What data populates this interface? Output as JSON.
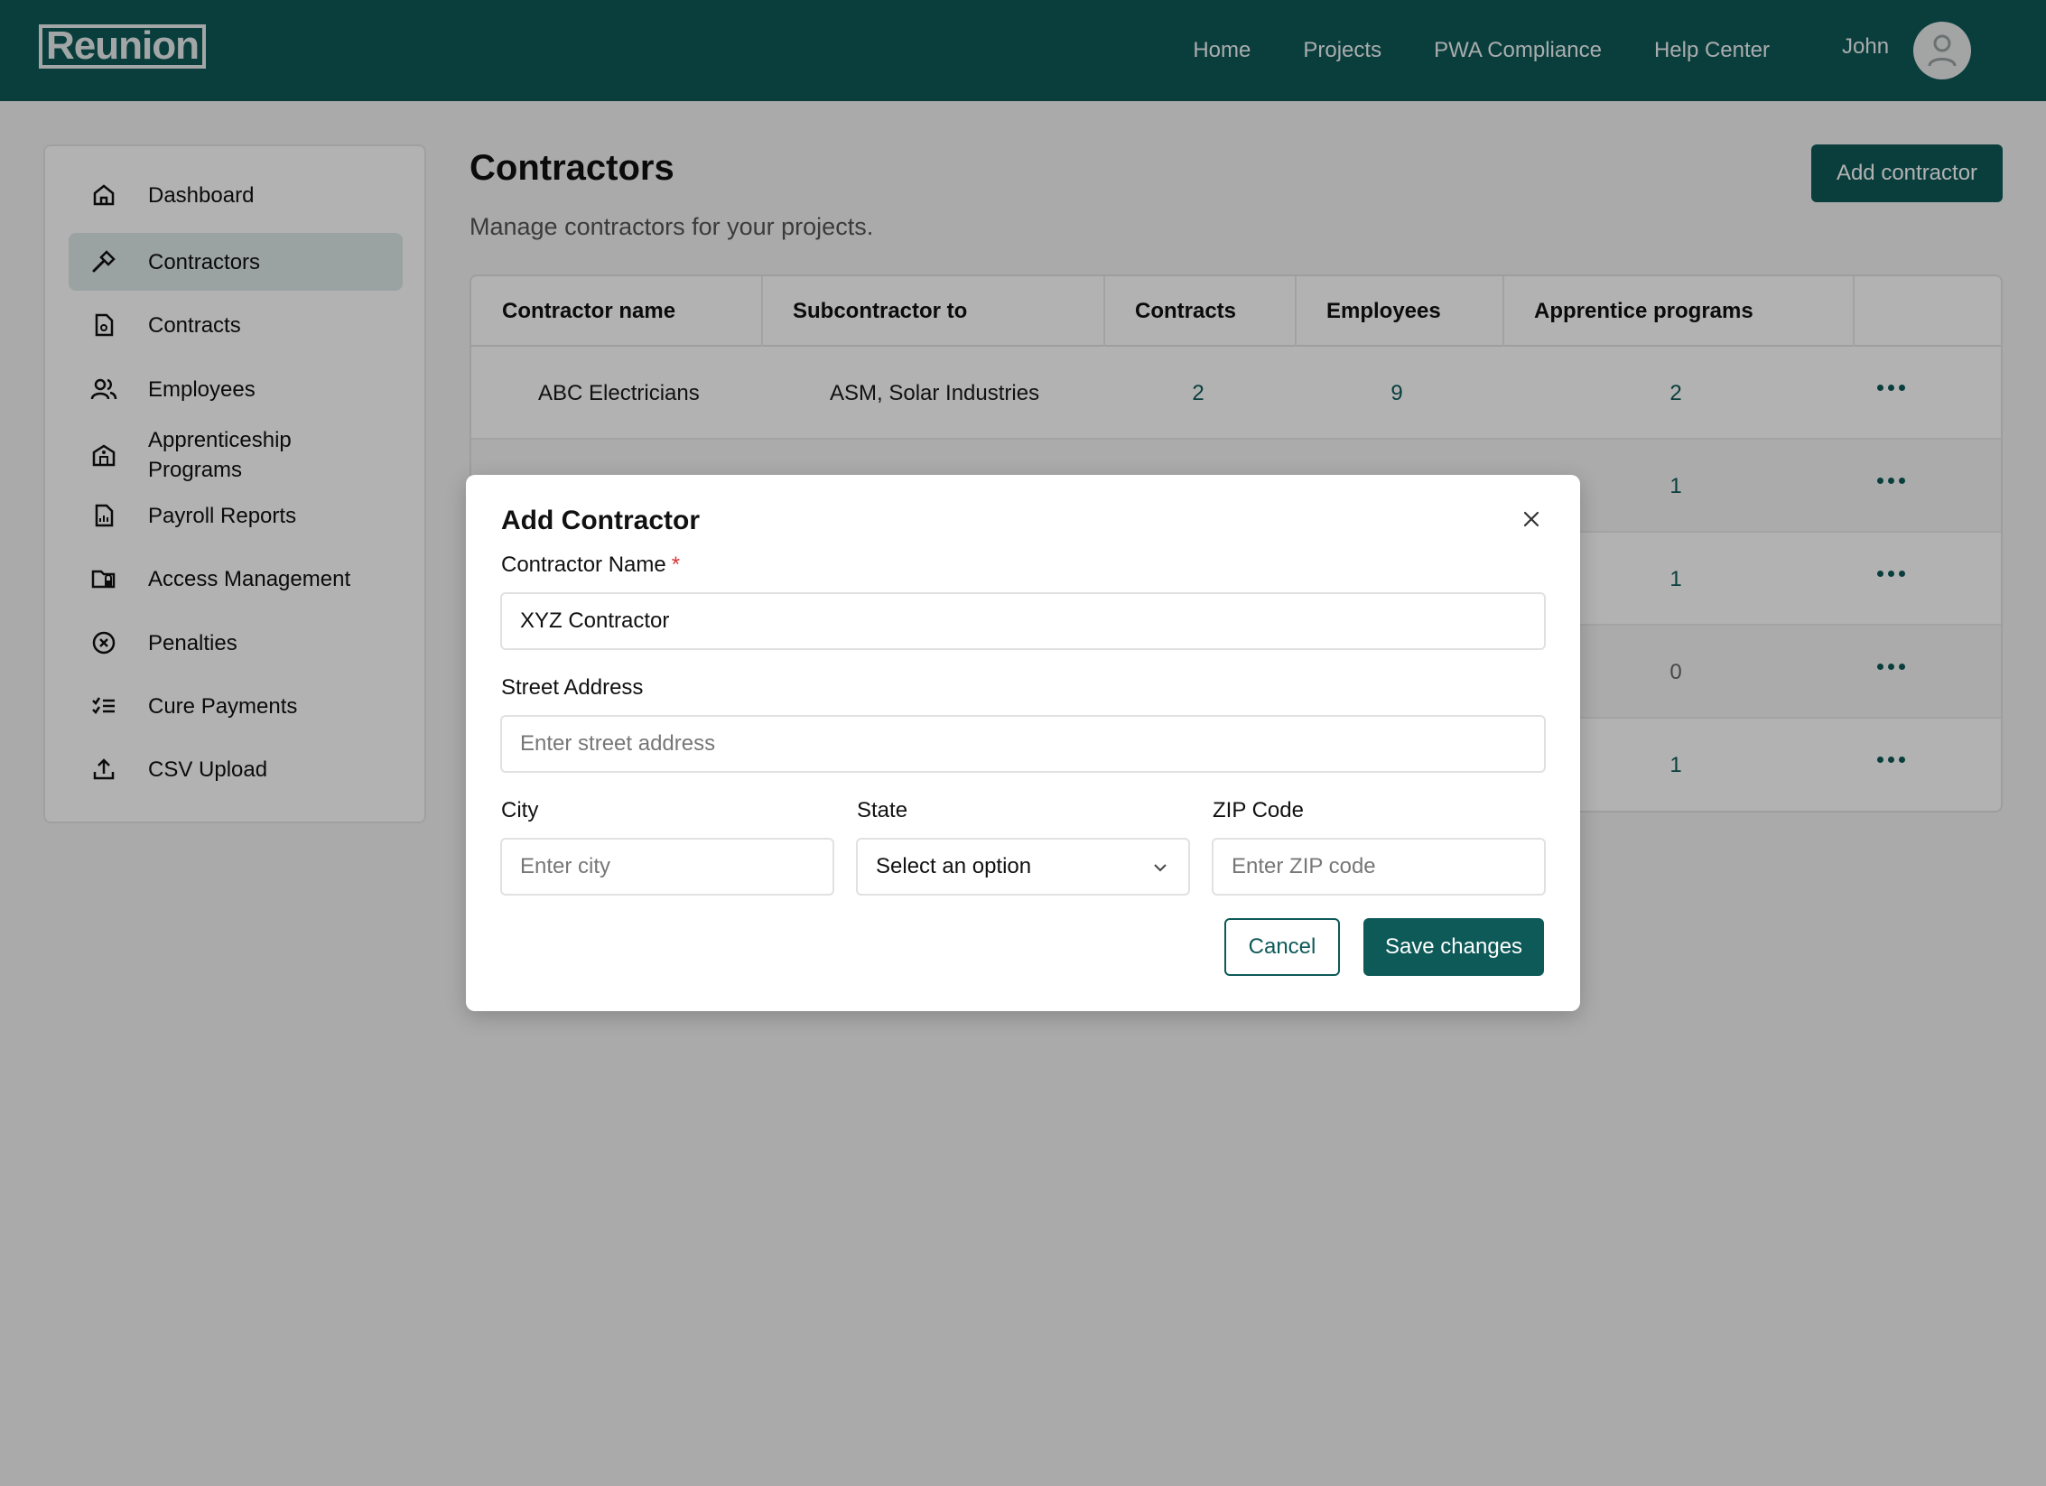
{
  "header": {
    "logo": "Reunion",
    "nav": [
      "Home",
      "Projects",
      "PWA Compliance",
      "Help Center"
    ],
    "user_name": "John"
  },
  "sidebar": {
    "items": [
      {
        "label": "Dashboard",
        "icon": "home-icon"
      },
      {
        "label": "Contractors",
        "icon": "hammer-icon",
        "active": true
      },
      {
        "label": "Contracts",
        "icon": "file-icon"
      },
      {
        "label": "Employees",
        "icon": "users-icon"
      },
      {
        "label": "Apprenticeship Programs",
        "icon": "school-icon"
      },
      {
        "label": "Payroll Reports",
        "icon": "report-icon"
      },
      {
        "label": "Access Management",
        "icon": "folder-lock-icon"
      },
      {
        "label": "Penalties",
        "icon": "circle-x-icon"
      },
      {
        "label": "Cure Payments",
        "icon": "checklist-icon"
      },
      {
        "label": "CSV Upload",
        "icon": "upload-icon"
      }
    ]
  },
  "main": {
    "title": "Contractors",
    "subtitle": "Manage contractors for your projects.",
    "add_button": "Add contractor",
    "table": {
      "columns": [
        "Contractor name",
        "Subcontractor to",
        "Contracts",
        "Employees",
        "Apprentice programs"
      ],
      "rows": [
        {
          "name": "ABC Electricians",
          "subcontractor_to": "ASM, Solar Industries",
          "contracts": "2",
          "employees": "9",
          "apprentice_programs": "2"
        },
        {
          "name": "",
          "subcontractor_to": "",
          "contracts": "",
          "employees": "",
          "apprentice_programs": "1"
        },
        {
          "name": "",
          "subcontractor_to": "",
          "contracts": "",
          "employees": "",
          "apprentice_programs": "1"
        },
        {
          "name": "",
          "subcontractor_to": "",
          "contracts": "",
          "employees": "",
          "apprentice_programs": "0"
        },
        {
          "name": "",
          "subcontractor_to": "",
          "contracts": "",
          "employees": "",
          "apprentice_programs": "1"
        }
      ]
    }
  },
  "modal": {
    "title": "Add Contractor",
    "contractor_name_label": "Contractor Name",
    "required_mark": "*",
    "contractor_name_value": "XYZ Contractor",
    "street_label": "Street Address",
    "street_placeholder": "Enter street address",
    "city_label": "City",
    "city_placeholder": "Enter city",
    "state_label": "State",
    "state_value": "Select an option",
    "zip_label": "ZIP Code",
    "zip_placeholder": "Enter ZIP code",
    "cancel": "Cancel",
    "save": "Save changes"
  },
  "colors": {
    "brand": "#0d5a58",
    "required": "#dd3333"
  }
}
